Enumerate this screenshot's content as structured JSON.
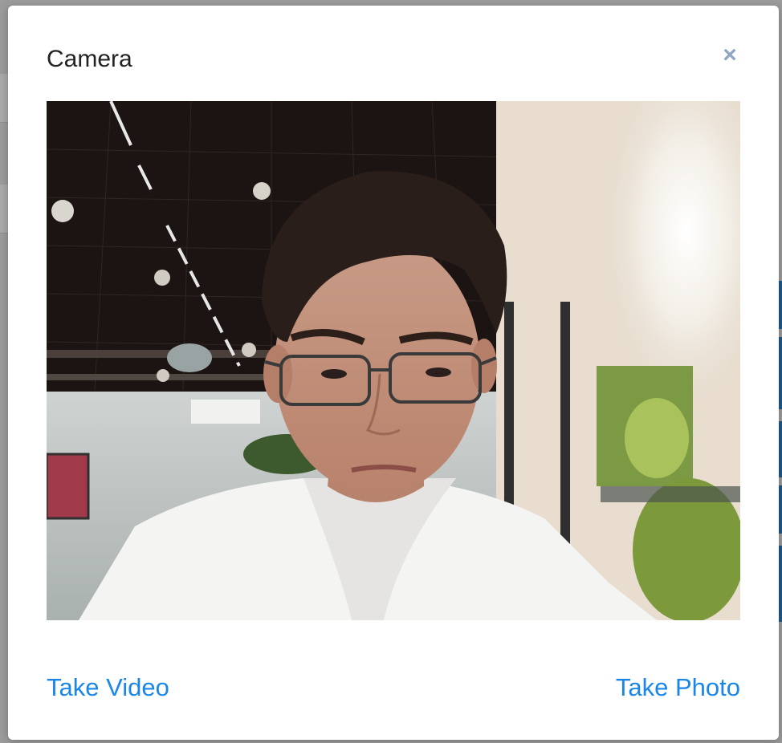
{
  "modal": {
    "title": "Camera",
    "close_icon": "close-icon",
    "close_glyph": "×"
  },
  "footer": {
    "take_video_label": "Take Video",
    "take_photo_label": "Take Photo"
  },
  "colors": {
    "accent": "#1a87e6",
    "close": "#8fa7c4",
    "title": "#222222"
  }
}
